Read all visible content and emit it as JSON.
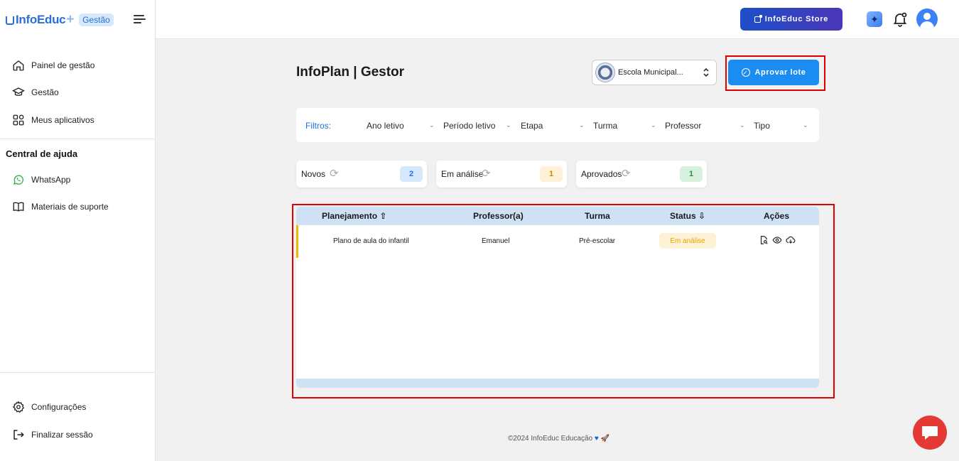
{
  "brand": {
    "name": "InfoEduc",
    "badge": "Gestão"
  },
  "sidebar": {
    "items": [
      {
        "label": "Painel de gestão",
        "icon": "home-icon"
      },
      {
        "label": "Gestão",
        "icon": "graduation-cap-icon"
      },
      {
        "label": "Meus aplicativos",
        "icon": "apps-icon"
      }
    ],
    "help_title": "Central de ajuda",
    "help_items": [
      {
        "label": "WhatsApp",
        "icon": "whatsapp-icon"
      },
      {
        "label": "Materiais de suporte",
        "icon": "book-icon"
      }
    ],
    "bottom_items": [
      {
        "label": "Configurações",
        "icon": "gear-icon"
      },
      {
        "label": "Finalizar sessão",
        "icon": "logout-icon"
      }
    ]
  },
  "topbar": {
    "store_label": "InfoEduc Store"
  },
  "main": {
    "title": "InfoPlan | Gestor",
    "school_select": "Escola Municipal...",
    "approve_label": "Aprovar lote"
  },
  "filters": {
    "label": "Filtros:",
    "items": [
      "Ano letivo",
      "Período letivo",
      "Etapa",
      "Turma",
      "Professor",
      "Tipo"
    ]
  },
  "stats": [
    {
      "label": "Novos",
      "count": "2",
      "color": "#d6e8fb",
      "text_color": "#1a73e8"
    },
    {
      "label": "Em análise",
      "count": "1",
      "color": "#fdf1d6",
      "text_color": "#c98a00"
    },
    {
      "label": "Aprovados",
      "count": "1",
      "color": "#d7f1de",
      "text_color": "#2e8b45"
    }
  ],
  "table": {
    "headers": [
      "Planejamento",
      "Professor(a)",
      "Turma",
      "Status",
      "Ações"
    ],
    "rows": [
      {
        "planejamento": "Plano de aula do infantil",
        "professor": "Emanuel",
        "turma": "Pré-escolar",
        "status": "Em análise"
      }
    ]
  },
  "footer": "©2024 InfoEduc Educação"
}
